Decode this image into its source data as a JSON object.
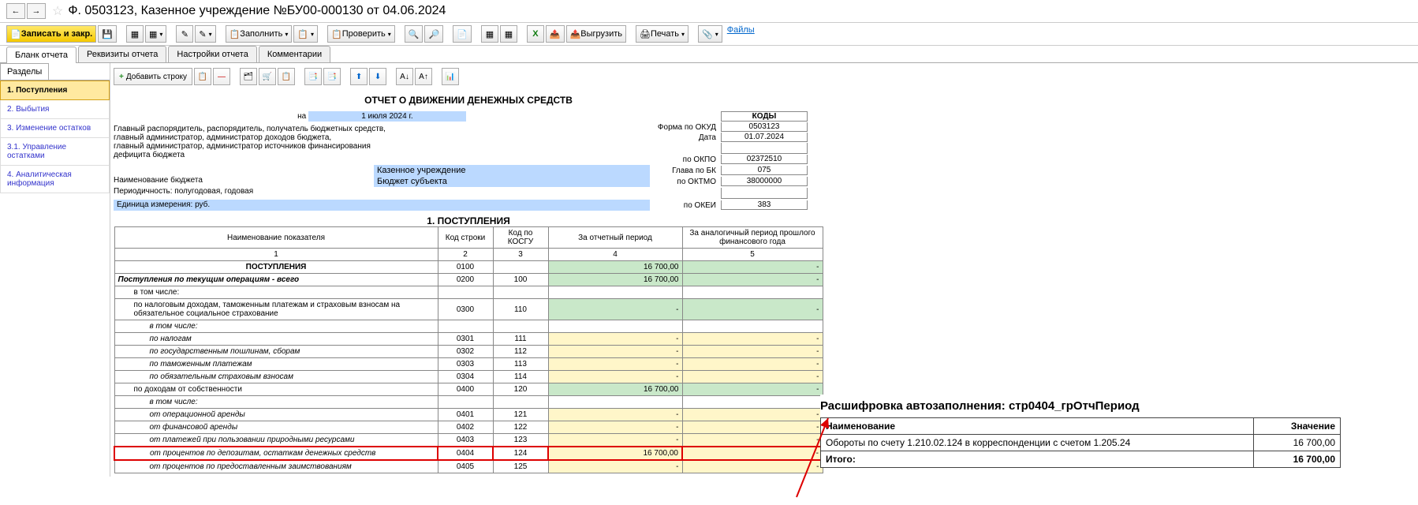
{
  "title": "Ф. 0503123, Казенное учреждение №БУ00-000130 от 04.06.2024",
  "toolbar": {
    "save_close": "Записать и закр.",
    "fill": "Заполнить",
    "check": "Проверить",
    "upload": "Выгрузить",
    "print": "Печать",
    "files": "Файлы"
  },
  "main_tabs": [
    "Бланк отчета",
    "Реквизиты отчета",
    "Настройки отчета",
    "Комментарии"
  ],
  "sub_tab": "Разделы",
  "sections": [
    {
      "label": "1. Поступления",
      "active": true
    },
    {
      "label": "2. Выбытия"
    },
    {
      "label": "3. Изменение остатков"
    },
    {
      "label": "3.1. Управление остатками"
    },
    {
      "label": "4. Аналитическая информация"
    }
  ],
  "mini_toolbar": {
    "add_row": "Добавить строку"
  },
  "report": {
    "title": "ОТЧЕТ О ДВИЖЕНИИ ДЕНЕЖНЫХ СРЕДСТВ",
    "date_prefix": "на",
    "date": "1 июля 2024 г.",
    "kody_label": "КОДЫ",
    "form_okud_label": "Форма по ОКУД",
    "form_okud": "0503123",
    "date2_label": "Дата",
    "date2": "01.07.2024",
    "rasp_lines": "Главный распорядитель, распорядитель, получатель бюджетных средств,\nглавный администратор, администратор доходов бюджета,\nглавный администратор, администратор источников финансирования\nдефицита бюджета",
    "okpo_label": "по ОКПО",
    "okpo": "02372510",
    "inst": "Казенное учреждение",
    "glava_label": "Глава по БК",
    "glava": "075",
    "budget_name_label": "Наименование бюджета",
    "budget_name": "Бюджет субъекта",
    "oktmo_label": "по ОКТМО",
    "oktmo": "38000000",
    "period_label": "Периодичность: полугодовая, годовая",
    "unit_label": "Единица измерения: руб.",
    "okei_label": "по ОКЕИ",
    "okei": "383",
    "section_caption": "1. ПОСТУПЛЕНИЯ",
    "table_headers": [
      "Наименование показателя",
      "Код строки",
      "Код по КОСГУ",
      "За отчетный период",
      "За аналогичный период прошлого финансового года"
    ],
    "col_nums": [
      "1",
      "2",
      "3",
      "4",
      "5"
    ],
    "rows": [
      {
        "name": "ПОСТУПЛЕНИЯ",
        "code": "0100",
        "kosgu": "",
        "v1": "16 700,00",
        "v2": "-",
        "c1": "green",
        "c2": "green",
        "bold": true,
        "center": true
      },
      {
        "name": "Поступления по текущим операциям - всего",
        "code": "0200",
        "kosgu": "100",
        "v1": "16 700,00",
        "v2": "-",
        "c1": "green",
        "c2": "green",
        "bold": true,
        "italic": true
      },
      {
        "name": "в том числе:",
        "ind": 1
      },
      {
        "name": "по налоговым доходам, таможенным платежам и страховым взносам на обязательное социальное страхование",
        "code": "0300",
        "kosgu": "110",
        "v1": "-",
        "v2": "-",
        "c1": "green",
        "c2": "green",
        "ind": 1
      },
      {
        "name": "в том числе:",
        "ind": 2,
        "italic": true
      },
      {
        "name": "по налогам",
        "code": "0301",
        "kosgu": "111",
        "v1": "-",
        "v2": "-",
        "c1": "yellow",
        "c2": "yellow",
        "ind": 2,
        "italic": true
      },
      {
        "name": "по государственным пошлинам, сборам",
        "code": "0302",
        "kosgu": "112",
        "v1": "-",
        "v2": "-",
        "c1": "yellow",
        "c2": "yellow",
        "ind": 2,
        "italic": true
      },
      {
        "name": "по таможенным платежам",
        "code": "0303",
        "kosgu": "113",
        "v1": "-",
        "v2": "-",
        "c1": "yellow",
        "c2": "yellow",
        "ind": 2,
        "italic": true
      },
      {
        "name": "по обязательным страховым взносам",
        "code": "0304",
        "kosgu": "114",
        "v1": "-",
        "v2": "-",
        "c1": "yellow",
        "c2": "yellow",
        "ind": 2,
        "italic": true
      },
      {
        "name": "по доходам от собственности",
        "code": "0400",
        "kosgu": "120",
        "v1": "16 700,00",
        "v2": "-",
        "c1": "green",
        "c2": "green",
        "ind": 1
      },
      {
        "name": "в том числе:",
        "ind": 2,
        "italic": true
      },
      {
        "name": "от операционной аренды",
        "code": "0401",
        "kosgu": "121",
        "v1": "-",
        "v2": "-",
        "c1": "yellow",
        "c2": "yellow",
        "ind": 2,
        "italic": true
      },
      {
        "name": "от финансовой аренды",
        "code": "0402",
        "kosgu": "122",
        "v1": "-",
        "v2": "-",
        "c1": "yellow",
        "c2": "yellow",
        "ind": 2,
        "italic": true
      },
      {
        "name": "от платежей при пользовании природными ресурсами",
        "code": "0403",
        "kosgu": "123",
        "v1": "-",
        "v2": "-",
        "c1": "yellow",
        "c2": "yellow",
        "ind": 2,
        "italic": true
      },
      {
        "name": "от процентов по депозитам, остаткам денежных средств",
        "code": "0404",
        "kosgu": "124",
        "v1": "16 700,00",
        "v2": "-",
        "c1": "yellow",
        "c2": "yellow",
        "ind": 2,
        "italic": true,
        "highlight": true
      },
      {
        "name": "от процентов по предоставленным заимствованиям",
        "code": "0405",
        "kosgu": "125",
        "v1": "-",
        "v2": "-",
        "c1": "yellow",
        "c2": "yellow",
        "ind": 2,
        "italic": true
      }
    ]
  },
  "popup": {
    "title": "Расшифровка автозаполнения: стр0404_грОтчПериод",
    "col1": "Наименование",
    "col2": "Значение",
    "row_name": "Обороты по счету 1.210.02.124 в корреспонденции с счетом 1.205.24",
    "row_val": "16 700,00",
    "total_label": "Итого:",
    "total_val": "16 700,00"
  }
}
